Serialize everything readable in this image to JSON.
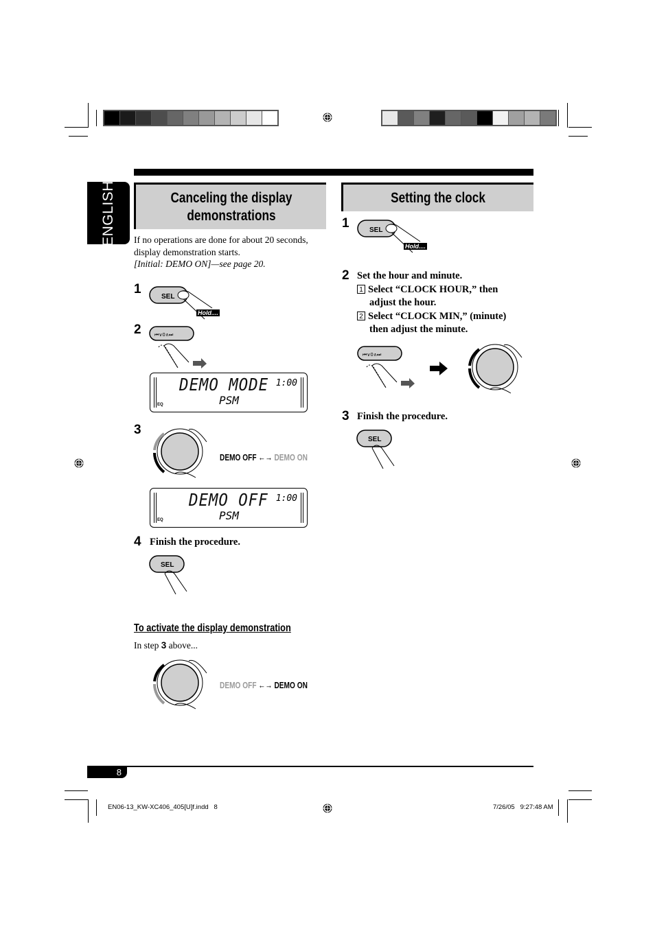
{
  "print_marks": {
    "left_swatches": [
      "#000000",
      "#1a1a1a",
      "#333333",
      "#4d4d4d",
      "#666666",
      "#808080",
      "#999999",
      "#b3b3b3",
      "#cccccc",
      "#e6e6e6",
      "#ffffff"
    ],
    "right_swatches": [
      "#e8e8e8",
      "#5a5a5a",
      "#808080",
      "#1f1f1f",
      "#666666",
      "#5a5a5a",
      "#000000",
      "#f2f2f2",
      "#a0a0a0",
      "#b3b3b3",
      "#7a7a7a"
    ]
  },
  "language_tab": "ENGLISH",
  "left": {
    "title": "Canceling the display demonstrations",
    "intro_1": "If no operations are done for about 20 seconds,",
    "intro_2": "display demonstration starts.",
    "intro_3": "[Initial: DEMO ON]—see page 20.",
    "steps": [
      {
        "num": "1",
        "button": "SEL",
        "hold": "Hold...."
      },
      {
        "num": "2",
        "button": "⏮∨0∧⏭"
      },
      {
        "num": "3"
      },
      {
        "num": "4",
        "text": "Finish the procedure.",
        "button": "SEL"
      }
    ],
    "lcd1": {
      "main": "DEMO MODE",
      "clock": "1:00",
      "sub": "PSM",
      "eq": "EQ"
    },
    "lcd2": {
      "main": "DEMO OFF",
      "clock": "1:00",
      "sub": "PSM",
      "eq": "EQ"
    },
    "toggle1": {
      "off": "DEMO OFF",
      "on": "DEMO ON",
      "active": "off"
    },
    "activate_title": "To activate the display demonstration",
    "activate_pre": "In step ",
    "activate_step": "3",
    "activate_post": " above...",
    "toggle2": {
      "off": "DEMO OFF",
      "on": "DEMO ON",
      "active": "on"
    }
  },
  "right": {
    "title": "Setting the clock",
    "steps": [
      {
        "num": "1",
        "button": "SEL",
        "hold": "Hold...."
      },
      {
        "num": "2",
        "text": "Set the hour and minute.",
        "sub": [
          {
            "n": "1",
            "line1": "Select “CLOCK HOUR,” then",
            "line2": "adjust the hour."
          },
          {
            "n": "2",
            "line1": "Select “CLOCK MIN,” (minute)",
            "line2": "then adjust the minute."
          }
        ],
        "button": "⏮∨0∧⏭"
      },
      {
        "num": "3",
        "text": "Finish the procedure.",
        "button": "SEL"
      }
    ]
  },
  "footer": {
    "page_number": "8",
    "file": "EN06-13_KW-XC406_405[U]f.indd   8",
    "datetime": "7/26/05   9:27:48 AM"
  }
}
